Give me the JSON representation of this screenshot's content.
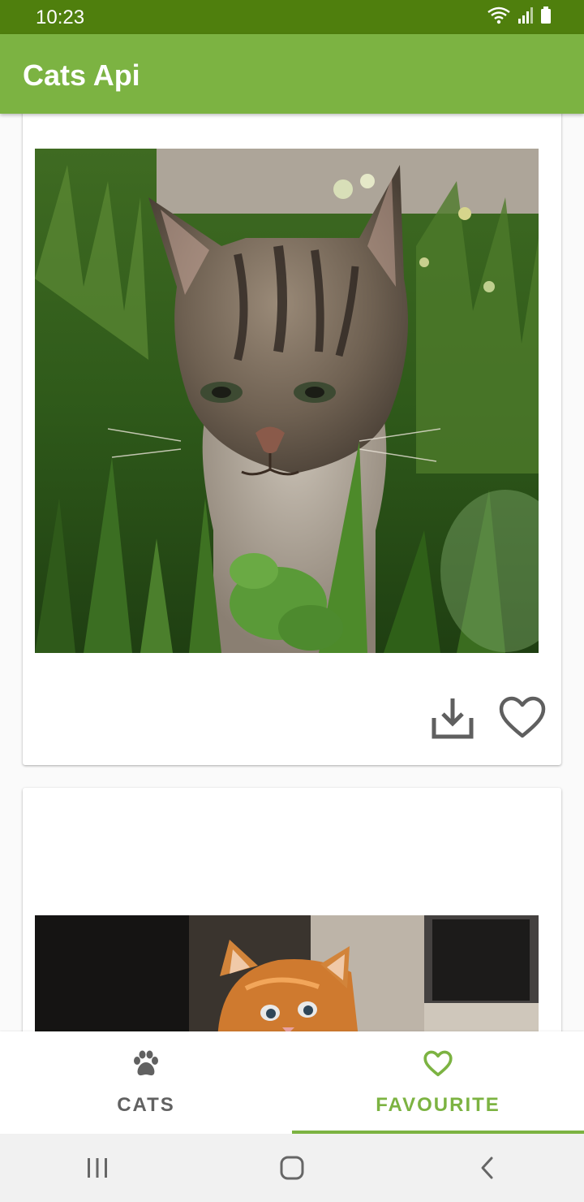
{
  "status_bar": {
    "time": "10:23",
    "icons": [
      "wifi-icon",
      "signal-icon",
      "battery-icon"
    ]
  },
  "app_bar": {
    "title": "Cats Api",
    "color": "#7cb342"
  },
  "feed": {
    "cards": [
      {
        "image": "tabby-kitten-in-grass-photo",
        "actions": [
          "download-icon",
          "heart-outline-icon"
        ]
      },
      {
        "image": "orange-kitten-photo"
      }
    ]
  },
  "bottom_tabs": {
    "items": [
      {
        "label": "CATS",
        "icon": "paw-icon",
        "selected": false
      },
      {
        "label": "FAVOURITE",
        "icon": "heart-outline-icon",
        "selected": true
      }
    ],
    "accent": "#7cb342",
    "inactive_color": "#616161"
  },
  "system_nav": {
    "buttons": [
      "recent-apps-icon",
      "home-icon",
      "back-icon"
    ]
  }
}
